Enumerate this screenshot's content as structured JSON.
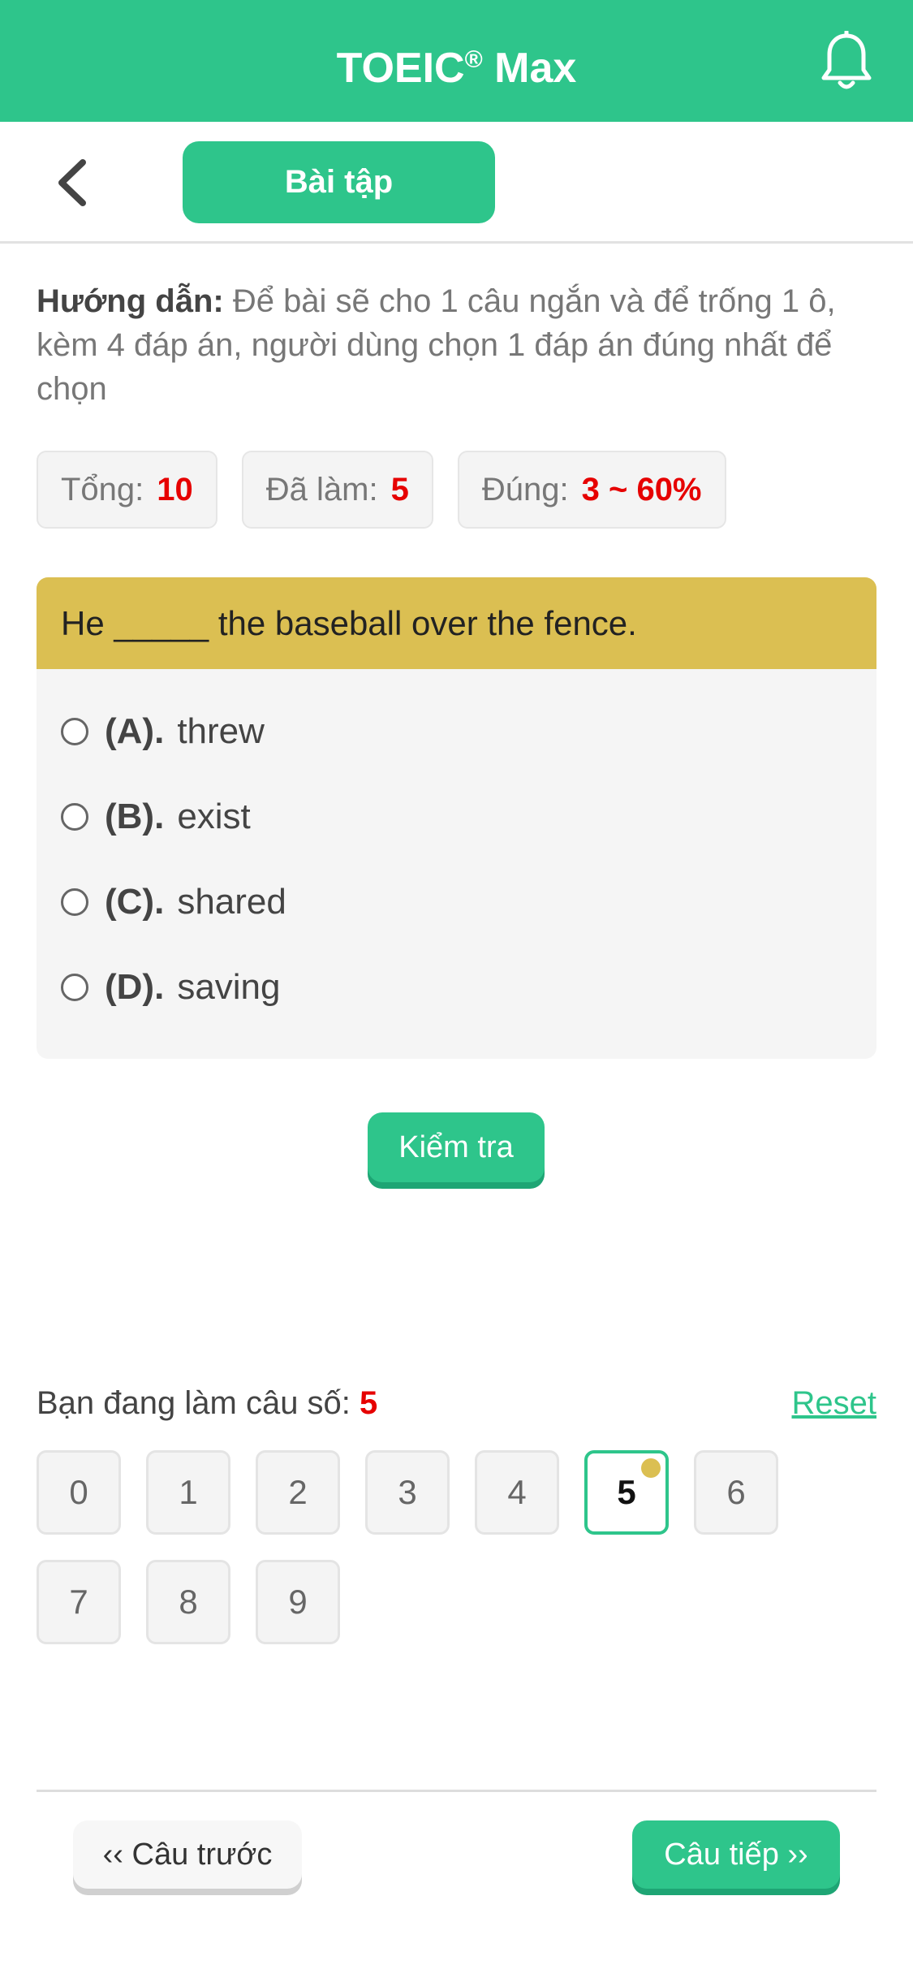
{
  "header": {
    "title_main": "TOEIC",
    "title_sup": "®",
    "title_rest": " Max",
    "icon": "bell-icon"
  },
  "toolbar": {
    "back_icon": "chevron-left-icon",
    "tab_label": "Bài tập"
  },
  "guide": {
    "label": "Hướng dẫn:",
    "text": " Để bài sẽ cho 1 câu ngắn và để trống 1 ô, kèm 4 đáp án, người dùng chọn 1 đáp án đúng nhất để chọn"
  },
  "stats": [
    {
      "label": "Tổng:",
      "value": "10"
    },
    {
      "label": "Đã làm:",
      "value": "5"
    },
    {
      "label": "Đúng:",
      "value": "3 ~ 60%"
    }
  ],
  "question": {
    "text": "He _____ the baseball over the fence.",
    "options": [
      {
        "key": "(A).",
        "text": "threw"
      },
      {
        "key": "(B).",
        "text": "exist"
      },
      {
        "key": "(C).",
        "text": "shared"
      },
      {
        "key": "(D).",
        "text": "saving"
      }
    ]
  },
  "check_button": "Kiểm tra",
  "progress": {
    "label": "Bạn đang làm câu số:",
    "current": "5",
    "reset": "Reset"
  },
  "question_numbers": [
    "0",
    "1",
    "2",
    "3",
    "4",
    "5",
    "6",
    "7",
    "8",
    "9"
  ],
  "active_question": "5",
  "nav": {
    "prev": "‹‹ Câu trước",
    "next": "Câu tiếp ››"
  },
  "colors": {
    "accent": "#2ec58b",
    "question_bar": "#dbbf52",
    "highlight": "#e60000"
  }
}
